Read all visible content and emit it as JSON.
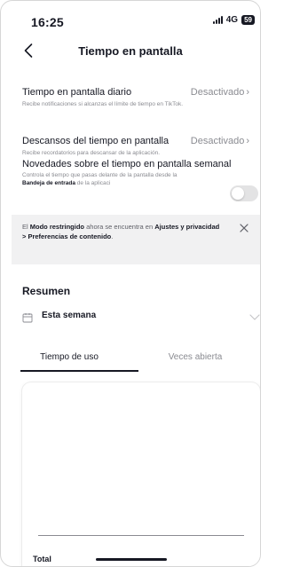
{
  "status": {
    "time": "16:25",
    "network": "4G",
    "battery": "59"
  },
  "header": {
    "title": "Tiempo en pantalla"
  },
  "settings": [
    {
      "title": "Tiempo en pantalla diario",
      "value": "Desactivado",
      "subtitle": "Recibe notificaciones si alcanzas el límite de tiempo en TikTok."
    },
    {
      "title": "Descansos del tiempo en pantalla",
      "value": "Desactivado",
      "subtitle": "Recibe recordatorios para descansar de la aplicación."
    }
  ],
  "weekly_update": {
    "title": "Novedades sobre el tiempo en pantalla semanal",
    "subtitle_prefix": "Controla el tiempo que pasas delante de la pantalla desde la ",
    "subtitle_bold": "Bandeja de entrada",
    "subtitle_suffix": " de la aplicaci",
    "toggle_on": false
  },
  "notice": {
    "prefix": "El ",
    "bold1": "Modo restringido",
    "middle": " ahora se encuentra en ",
    "bold2": "Ajustes y privacidad > Preferencias de contenido",
    "suffix": "."
  },
  "summary": {
    "title": "Resumen",
    "period": "Esta semana",
    "tabs": [
      "Tiempo de uso",
      "Veces abierta"
    ],
    "active_tab": 0,
    "total_label": "Total"
  },
  "colors": {
    "text": "#161823",
    "muted": "#8a8b91",
    "banner": "#f1f1f2",
    "toggle_off": "#e3e3e4"
  },
  "icons": [
    "back-icon",
    "chevron-right-icon",
    "close-icon",
    "calendar-icon",
    "chevron-down-icon"
  ]
}
